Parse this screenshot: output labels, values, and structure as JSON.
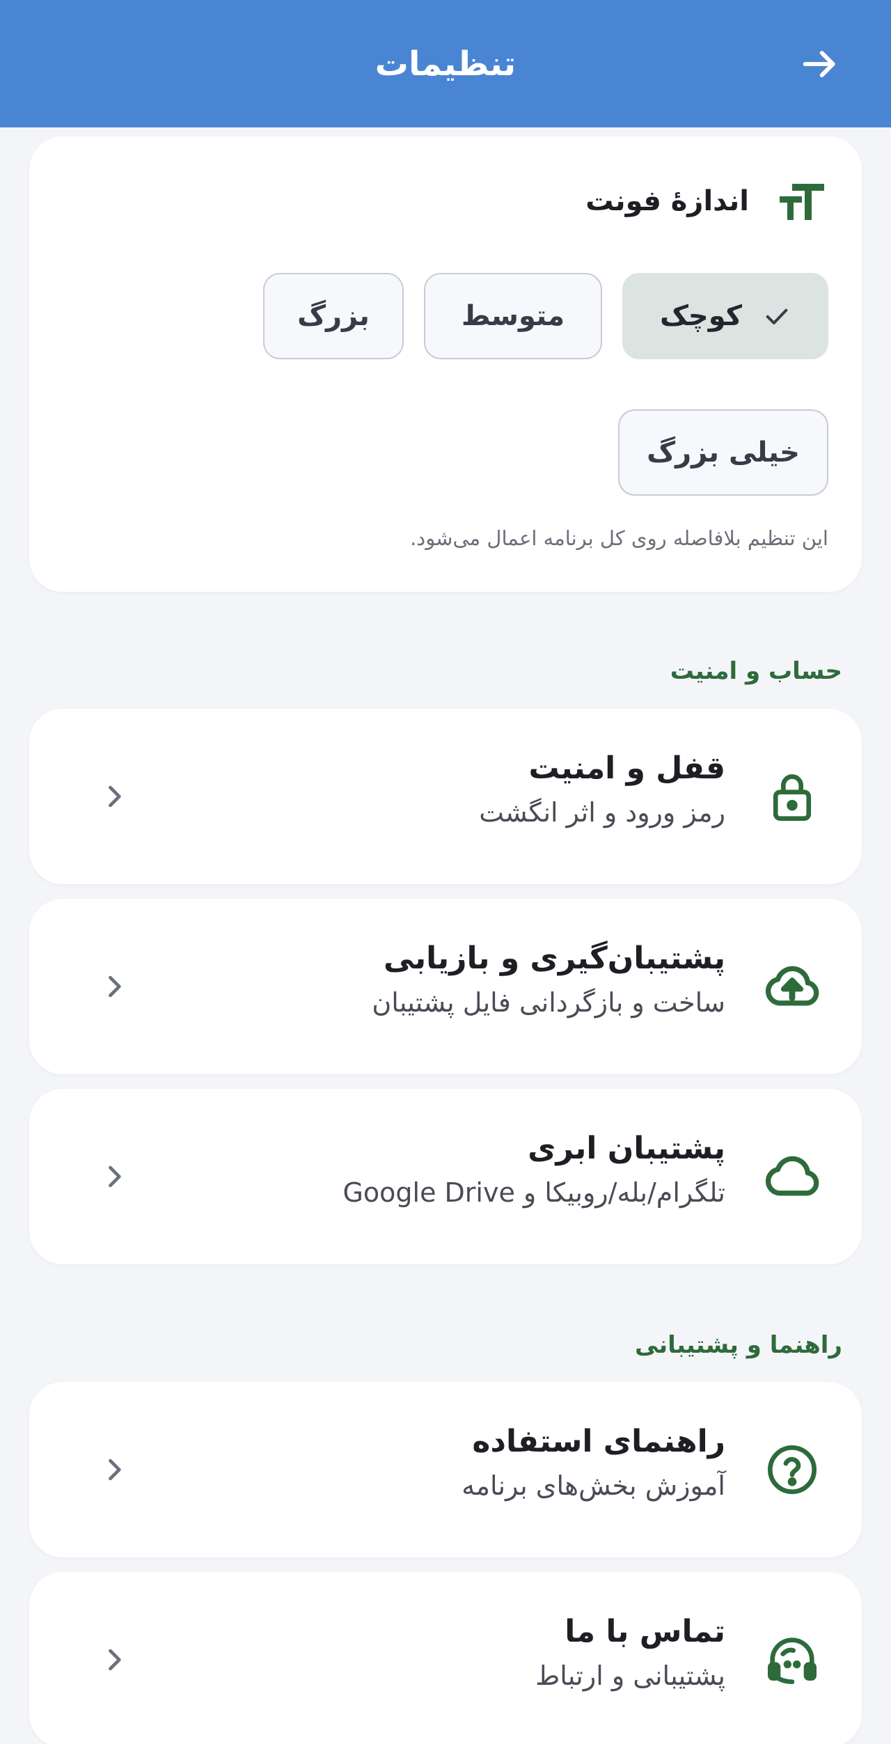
{
  "header": {
    "title": "تنظیمات",
    "back_icon": "arrow-right-icon",
    "background_color": "#4a85d4"
  },
  "font_size": {
    "icon": "text-size-icon",
    "title": "اندازهٔ فونت",
    "options": [
      {
        "label": "کوچک",
        "selected": true
      },
      {
        "label": "متوسط",
        "selected": false
      },
      {
        "label": "بزرگ",
        "selected": false
      },
      {
        "label": "خیلی بزرگ",
        "selected": false
      }
    ],
    "note": "این تنظیم بلافاصله روی کل برنامه اعمال می‌شود."
  },
  "sections": [
    {
      "header": "حساب و امنیت",
      "items": [
        {
          "icon": "lock-icon",
          "title": "قفل و امنیت",
          "subtitle": "رمز ورود و اثر انگشت"
        },
        {
          "icon": "cloud-upload-icon",
          "title": "پشتیبان‌گیری و بازیابی",
          "subtitle": "ساخت و بازگردانی فایل پشتیبان"
        },
        {
          "icon": "cloud-icon",
          "title": "پشتیبان ابری",
          "subtitle": "تلگرام/بله/روبیکا و Google Drive"
        }
      ]
    },
    {
      "header": "راهنما و پشتیبانی",
      "items": [
        {
          "icon": "help-icon",
          "title": "راهنمای استفاده",
          "subtitle": "آموزش بخش‌های برنامه"
        },
        {
          "icon": "headset-icon",
          "title": "تماس با ما",
          "subtitle": "پشتیبانی و ارتباط"
        }
      ]
    }
  ],
  "colors": {
    "accent_green": "#2e6b3b",
    "chevron_gray": "#6b7080",
    "selected_chip": "#dbe4e1"
  }
}
